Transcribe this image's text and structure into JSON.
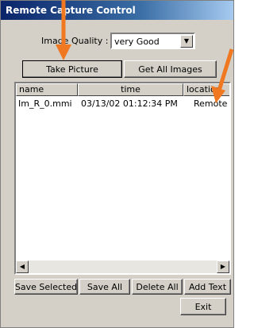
{
  "window": {
    "title": "Remote Capture Control"
  },
  "image_quality": {
    "label": "Image Quality :",
    "selected": "very Good"
  },
  "buttons": {
    "take_picture": "Take Picture",
    "get_all_images": "Get All Images",
    "save_selected": "Save Selected",
    "save_all": "Save All",
    "delete_all": "Delete All",
    "add_text": "Add Text",
    "exit": "Exit"
  },
  "list": {
    "columns": [
      "name",
      "time",
      "location"
    ],
    "rows": [
      {
        "name": "Im_R_0.mmi",
        "time": "03/13/02  01:12:34 PM",
        "location": "Remote"
      }
    ]
  },
  "icons": {
    "dropdown": "chevron-down-icon",
    "scroll_left": "arrow-left-icon",
    "scroll_right": "arrow-right-icon",
    "annotation_arrow": "arrow-icon"
  },
  "colors": {
    "title_bar": "#0a246a",
    "annotation_arrow": "#f07820",
    "face": "#d4d0c8"
  }
}
